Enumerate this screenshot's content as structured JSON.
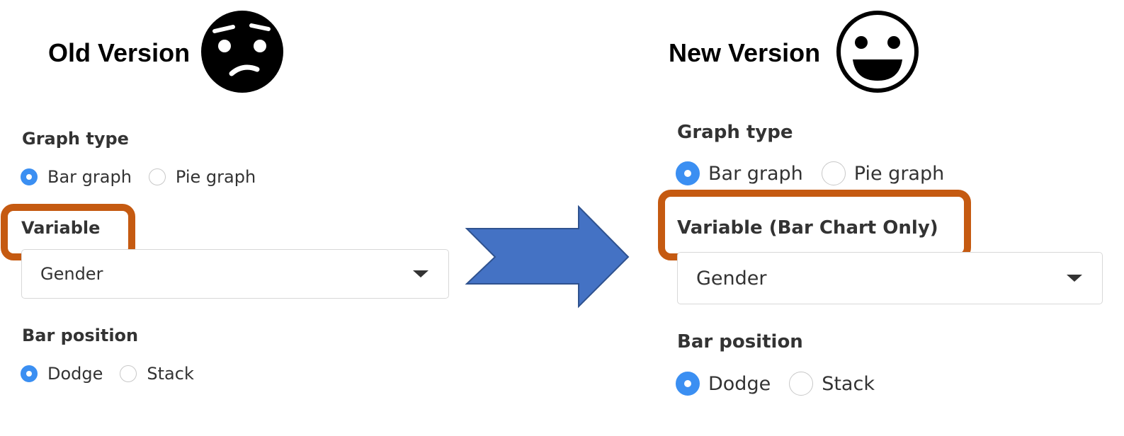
{
  "old_version": {
    "title": "Old Version",
    "face_icon": "confused-face-icon",
    "graph_type": {
      "label": "Graph type",
      "options": [
        {
          "label": "Bar graph",
          "checked": true
        },
        {
          "label": "Pie graph",
          "checked": false
        }
      ]
    },
    "variable": {
      "label": "Variable",
      "selected": "Gender"
    },
    "bar_position": {
      "label": "Bar position",
      "options": [
        {
          "label": "Dodge",
          "checked": true
        },
        {
          "label": "Stack",
          "checked": false
        }
      ]
    }
  },
  "new_version": {
    "title": "New Version",
    "face_icon": "happy-face-icon",
    "graph_type": {
      "label": "Graph type",
      "options": [
        {
          "label": "Bar graph",
          "checked": true
        },
        {
          "label": "Pie graph",
          "checked": false
        }
      ]
    },
    "variable": {
      "label": "Variable (Bar Chart Only)",
      "selected": "Gender"
    },
    "bar_position": {
      "label": "Bar position",
      "options": [
        {
          "label": "Dodge",
          "checked": true
        },
        {
          "label": "Stack",
          "checked": false
        }
      ]
    }
  },
  "colors": {
    "highlight": "#c55a11",
    "arrow": "#4472c4",
    "radio_checked": "#3b8ff2"
  }
}
